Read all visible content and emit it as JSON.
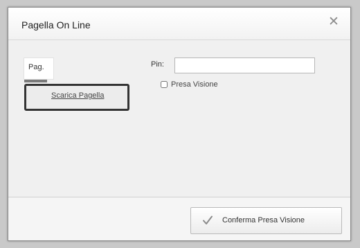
{
  "dialog": {
    "title": "Pagella On Line",
    "close_icon": "close-icon"
  },
  "tab": {
    "label": "Pag."
  },
  "download_button": {
    "label": "Scarica Pagella"
  },
  "pin": {
    "label": "Pin:",
    "value": ""
  },
  "presa_visione": {
    "label": "Presa Visione",
    "checked": false
  },
  "confirm_button": {
    "label": "Conferma Presa Visione",
    "icon": "checkmark-icon",
    "icon_color": "#8a8a8a"
  }
}
